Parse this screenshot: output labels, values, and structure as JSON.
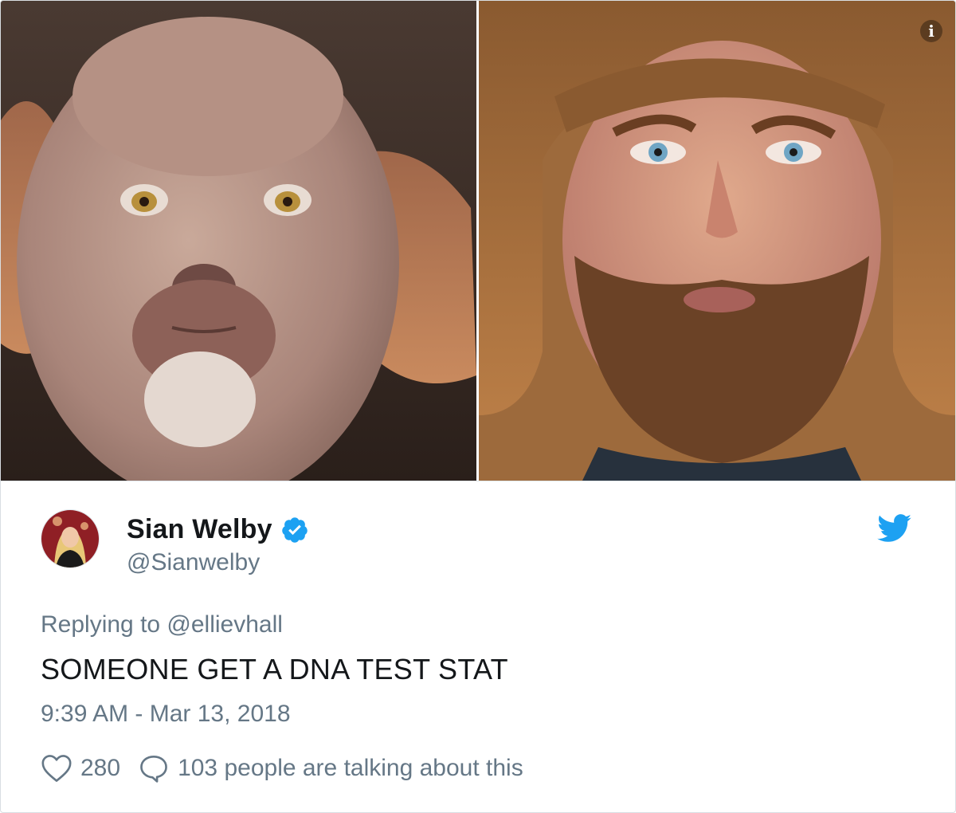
{
  "media": {
    "left_image": "dog-photo",
    "right_image": "bearded-man-photo",
    "info_icon": "info-icon"
  },
  "tweet": {
    "author_name": "Sian Welby",
    "author_handle": "@Sianwelby",
    "verified": true,
    "replying_to": "Replying to @ellievhall",
    "text": "SOMEONE GET A DNA TEST STAT",
    "timestamp": "9:39 AM - Mar 13, 2018",
    "likes": "280",
    "talking": "103 people are talking about this"
  },
  "icons": {
    "brand": "twitter-bird-icon",
    "verified": "verified-badge-icon",
    "like": "heart-icon",
    "reply": "speech-bubble-icon"
  },
  "colors": {
    "twitter_blue": "#1da1f2",
    "secondary_text": "#657786",
    "primary_text": "#14171a"
  }
}
